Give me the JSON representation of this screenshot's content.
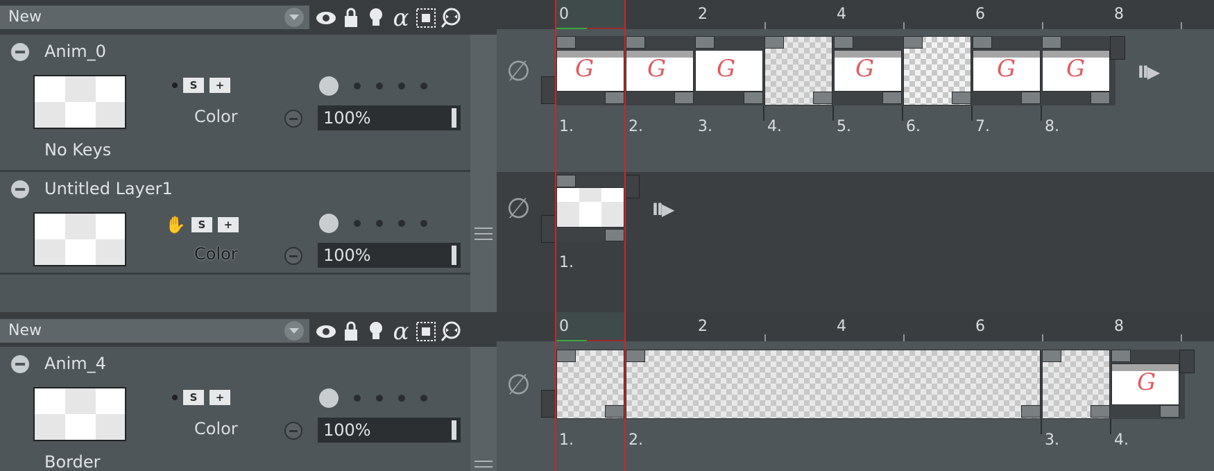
{
  "group1": {
    "dropdown_label": "New",
    "ruler_numbers": [
      "0",
      "2",
      "4",
      "6",
      "8"
    ],
    "layers": [
      {
        "name": "Anim_0",
        "color_label": "Color",
        "opacity": "100%",
        "sub_label": "No Keys",
        "cel_numbers": [
          "1.",
          "2.",
          "3.",
          "4.",
          "5.",
          "6.",
          "7.",
          "8."
        ]
      },
      {
        "name": "Untitled Layer1",
        "color_label": "Color",
        "opacity": "100%",
        "cel_numbers": [
          "1."
        ]
      }
    ]
  },
  "group2": {
    "dropdown_label": "New",
    "ruler_numbers": [
      "0",
      "2",
      "4",
      "6",
      "8"
    ],
    "layers": [
      {
        "name": "Anim_4",
        "color_label": "Color",
        "opacity": "100%",
        "sub_label": "Border",
        "cel_numbers": [
          "1.",
          "2.",
          "3.",
          "4."
        ]
      }
    ]
  },
  "icons": {
    "toolbar": [
      "eye-icon",
      "lock-icon",
      "lightbulb-icon",
      "alpha-icon",
      "mask-select-icon",
      "onion-skin-icon"
    ],
    "layer_tools": [
      "swap-icon",
      "add-frame-icon"
    ],
    "null_symbol": "∅",
    "alpha_glyph": "α"
  },
  "colors": {
    "playhead": "#c9262b",
    "stroke": "#e05c60",
    "panel": "#4e5659"
  }
}
